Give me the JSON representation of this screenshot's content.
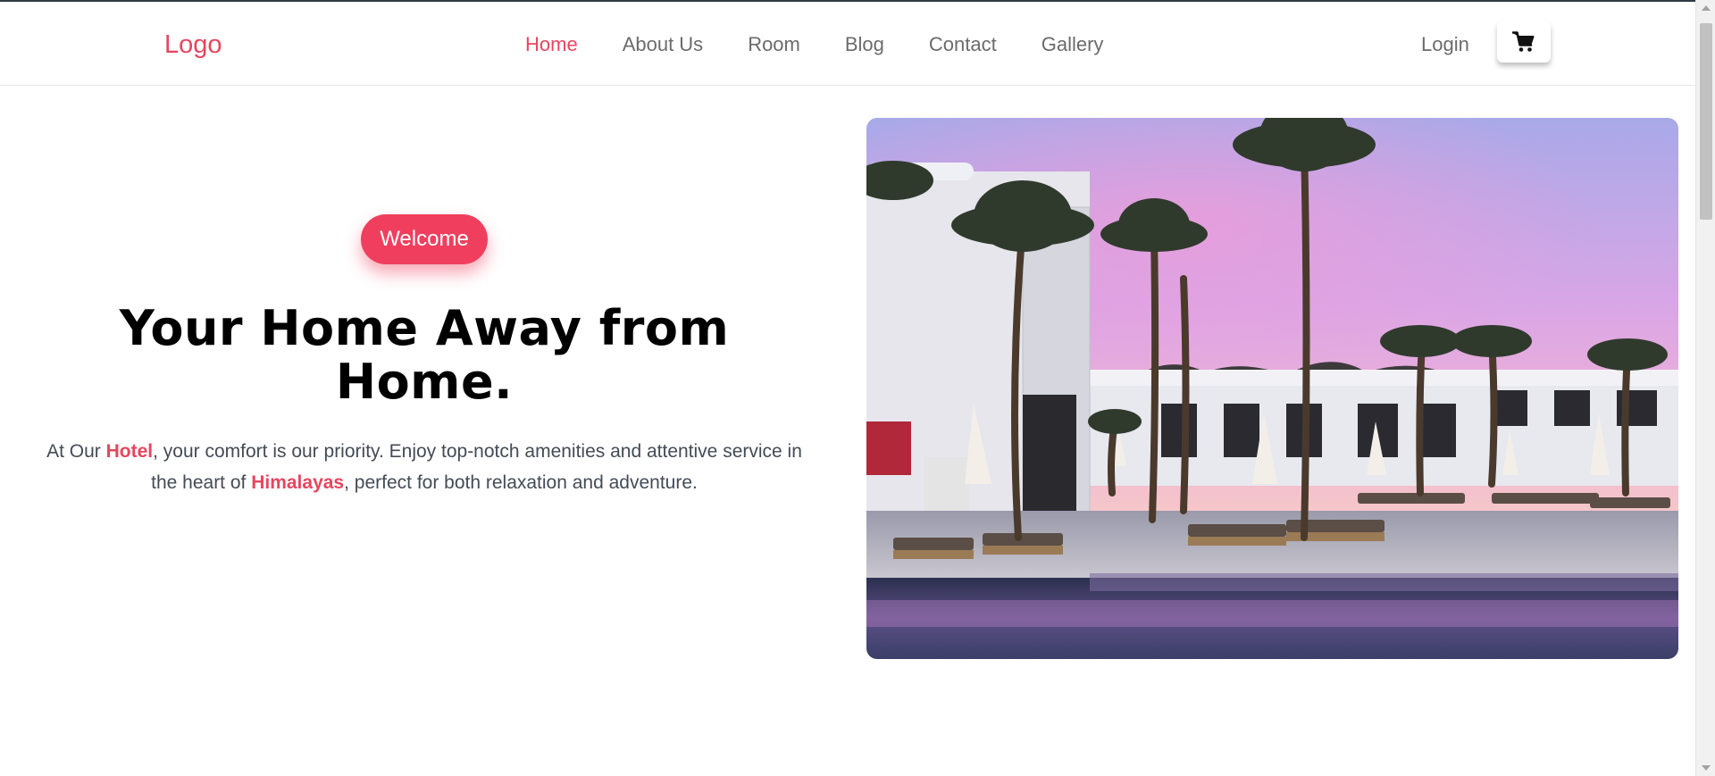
{
  "brand": {
    "logo_text": "Logo",
    "accent_color": "#e8455f"
  },
  "nav": {
    "items": [
      {
        "label": "Home",
        "active": true
      },
      {
        "label": "About Us",
        "active": false
      },
      {
        "label": "Room",
        "active": false
      },
      {
        "label": "Blog",
        "active": false
      },
      {
        "label": "Contact",
        "active": false
      },
      {
        "label": "Gallery",
        "active": false
      }
    ],
    "login_label": "Login",
    "cart_icon": "shopping-cart-icon"
  },
  "hero": {
    "badge_label": "Welcome",
    "headline": "Your Home Away from Home.",
    "description": {
      "part1": "At Our ",
      "highlight1": "Hotel",
      "part2": ", your comfort is our priority. Enjoy top-notch amenities and attentive service in the heart of ",
      "highlight2": "Himalayas",
      "part3": ", perfect for both relaxation and adventure."
    },
    "image_subject": "resort-pool-palm-trees-sunset"
  }
}
